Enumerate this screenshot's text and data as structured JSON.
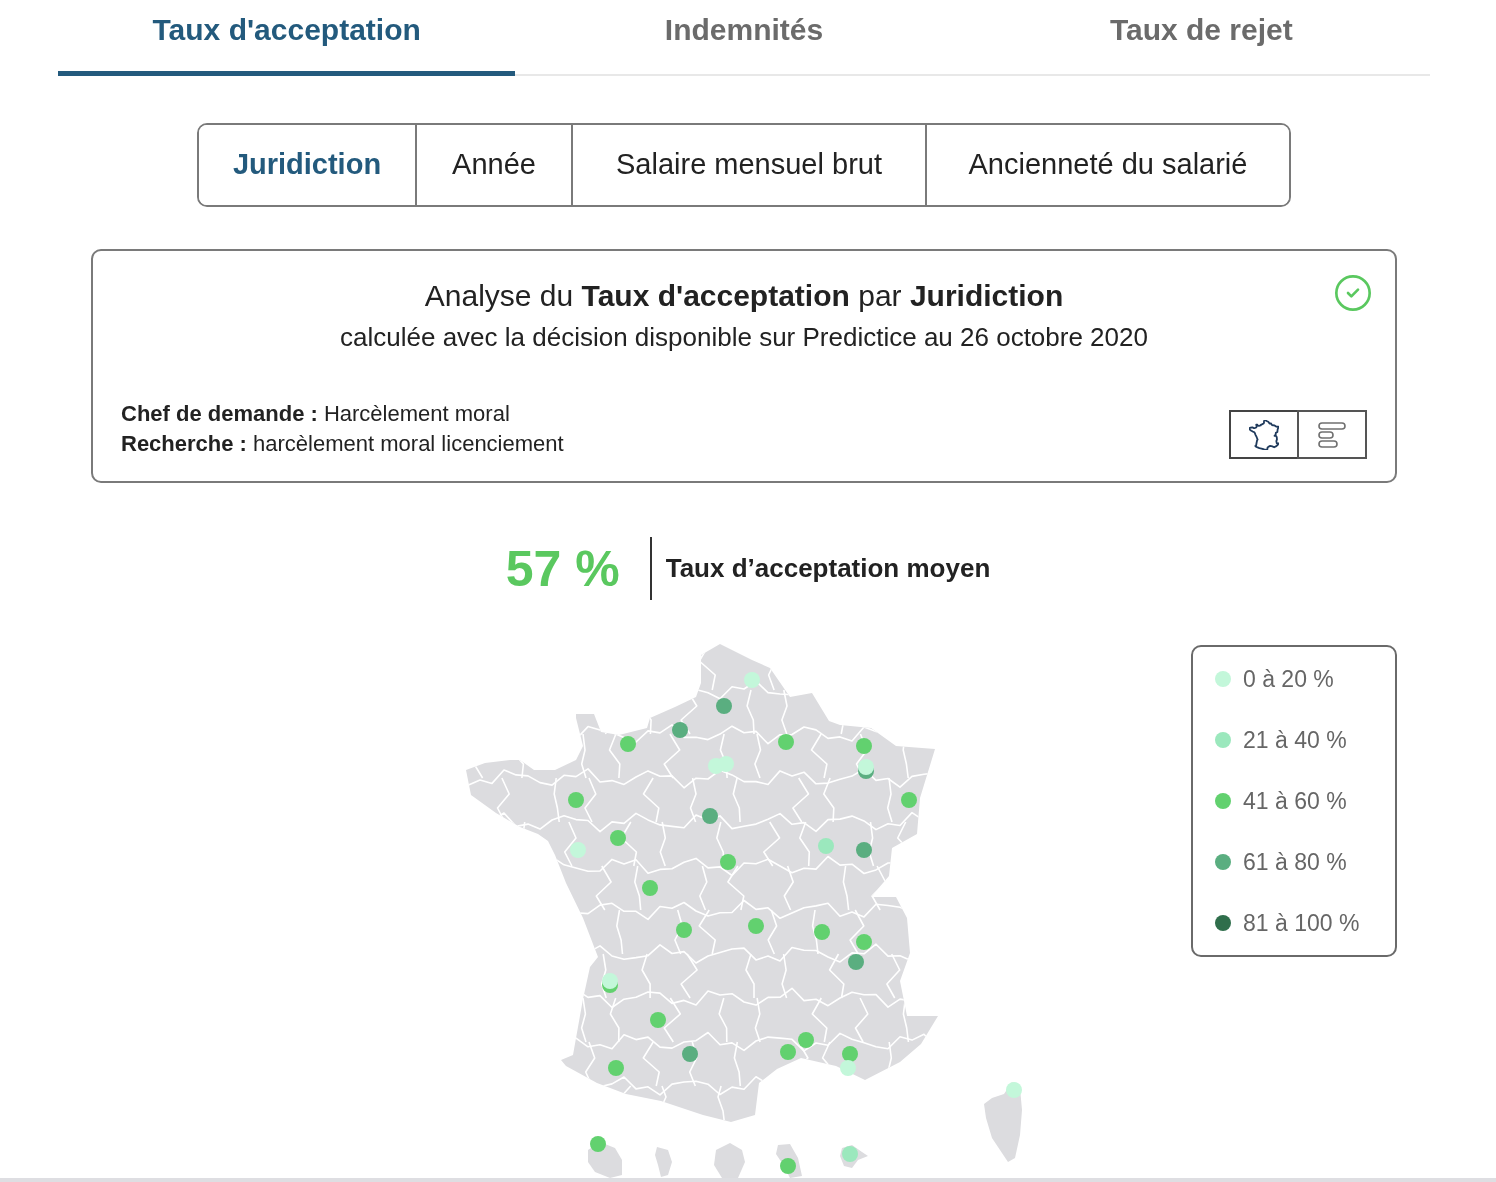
{
  "tabs": [
    {
      "label": "Taux d'acceptation",
      "selected": true
    },
    {
      "label": "Indemnités",
      "selected": false
    },
    {
      "label": "Taux de rejet",
      "selected": false
    }
  ],
  "dimension_tabs": [
    {
      "label": "Juridiction",
      "selected": true
    },
    {
      "label": "Année",
      "selected": false
    },
    {
      "label": "Salaire mensuel brut",
      "selected": false
    },
    {
      "label": "Ancienneté du salarié",
      "selected": false
    }
  ],
  "summary": {
    "title": "Analyse du **Taux d'acceptation** par **Juridiction**",
    "subtitle": "calculée avec la décision disponible sur Predictice au 26 octobre 2020",
    "criteria": [
      "**Chef de demande :** Harcèlement moral",
      "**Recherche :** harcèlement moral licenciement"
    ],
    "view_toggle": [
      {
        "kind": "map",
        "selected": true
      },
      {
        "kind": "bars",
        "selected": false
      }
    ]
  },
  "average": {
    "value": "57 %",
    "label": "Taux d’acceptation moyen"
  },
  "map": {
    "markers": [
      {
        "color": "#c3f7da"
      },
      {
        "color": "#5aae80"
      },
      {
        "color": "#5aae80"
      },
      {
        "color": "#62d16f"
      },
      {
        "color": "#62d16f"
      },
      {
        "color": "#62d16f"
      },
      {
        "color": "#c3f7da"
      },
      {
        "color": "#c3f7da"
      },
      {
        "color": "#5aae80"
      },
      {
        "color": "#c3f7da"
      },
      {
        "color": "#62d16f"
      },
      {
        "color": "#62d16f"
      },
      {
        "color": "#5aae80"
      },
      {
        "color": "#62d16f"
      },
      {
        "color": "#c3f7da"
      },
      {
        "color": "#9be8bd"
      },
      {
        "color": "#5aae80"
      },
      {
        "color": "#62d16f"
      },
      {
        "color": "#62d16f"
      },
      {
        "color": "#62d16f"
      },
      {
        "color": "#62d16f"
      },
      {
        "color": "#62d16f"
      },
      {
        "color": "#62d16f"
      },
      {
        "color": "#5aae80"
      },
      {
        "color": "#62d16f"
      },
      {
        "color": "#c3f7da"
      },
      {
        "color": "#62d16f"
      },
      {
        "color": "#5aae80"
      },
      {
        "color": "#62d16f"
      },
      {
        "color": "#62d16f"
      },
      {
        "color": "#62d16f"
      },
      {
        "color": "#62d16f"
      },
      {
        "color": "#c3f7da"
      },
      {
        "color": "#c3f7da"
      },
      {
        "color": "#62d16f"
      },
      {
        "color": "#62d16f"
      },
      {
        "color": "#9be8bd"
      }
    ]
  },
  "legend": [
    {
      "label": "0 à 20 %",
      "color": "#c3f7da"
    },
    {
      "label": "21 à 40 %",
      "color": "#9be8bd"
    },
    {
      "label": "41 à 60 %",
      "color": "#62d16f"
    },
    {
      "label": "61 à 80 %",
      "color": "#5aae80"
    },
    {
      "label": "81 à 100 %",
      "color": "#2f6e4b"
    }
  ]
}
